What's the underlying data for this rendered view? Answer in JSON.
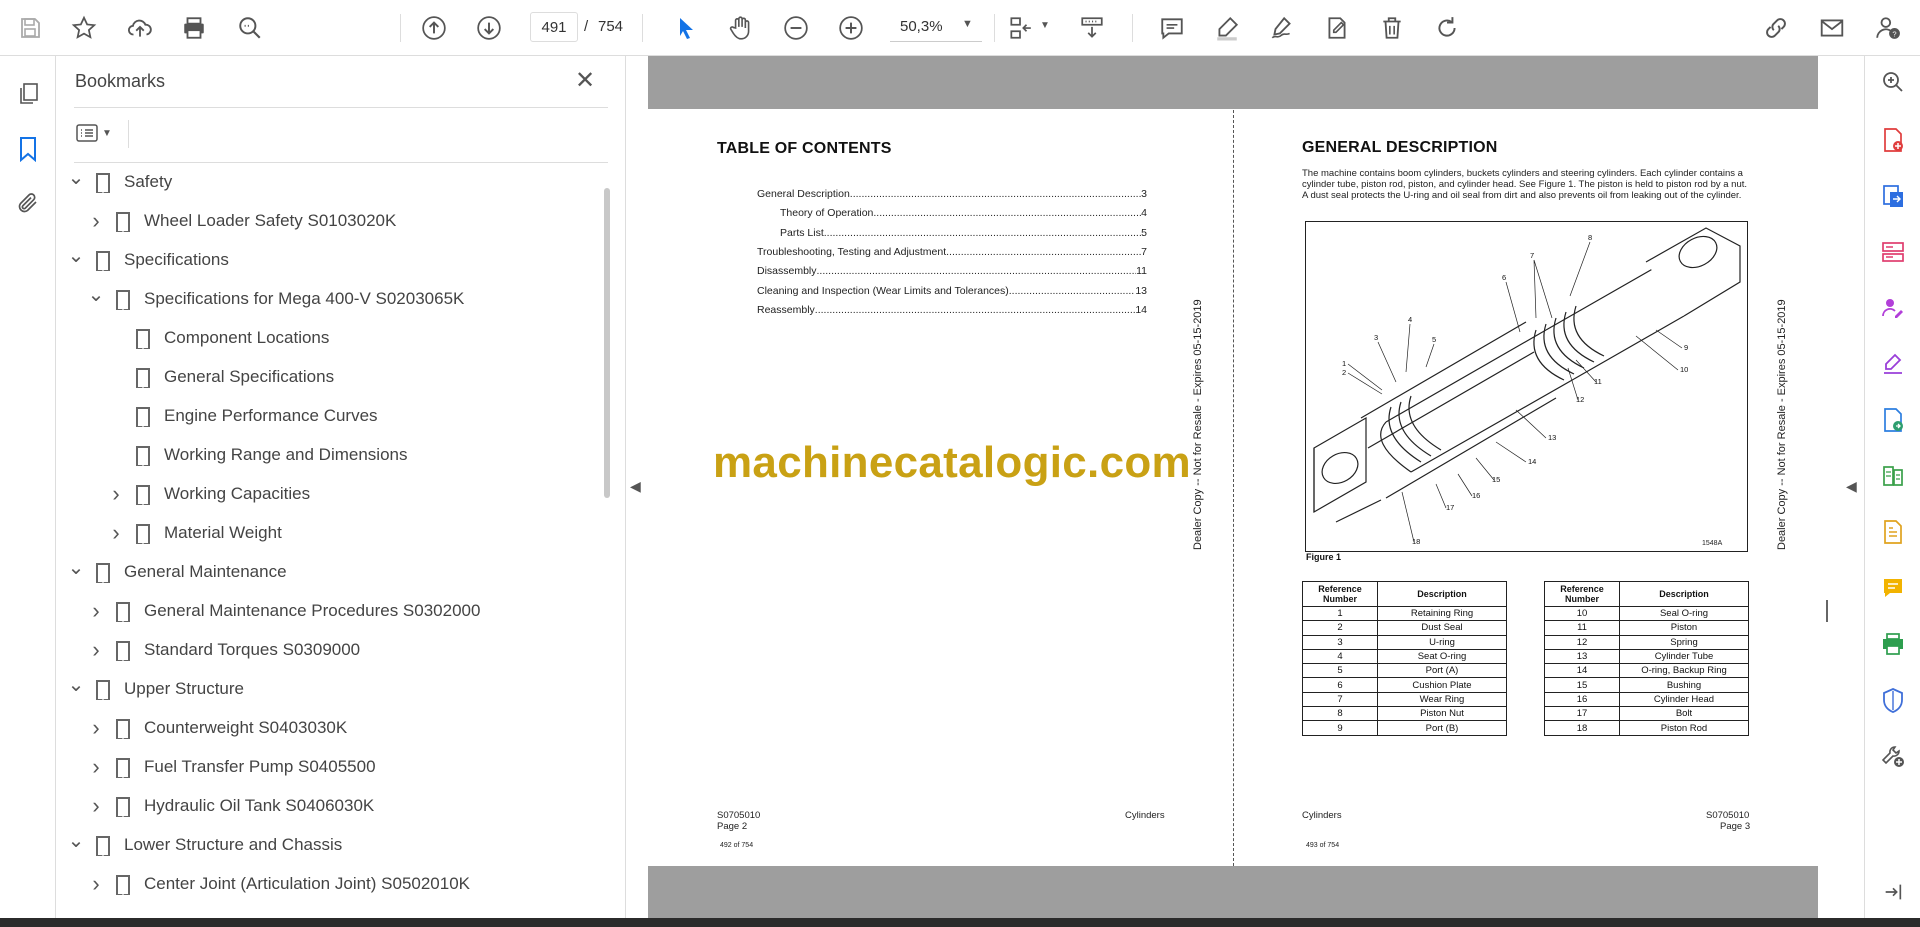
{
  "toolbar": {
    "page_current": "491",
    "page_separator": "/",
    "page_total": "754",
    "zoom": "50,3%"
  },
  "bookmarks": {
    "title": "Bookmarks",
    "items": [
      {
        "label": "Safety",
        "level": 0,
        "toggle": "open"
      },
      {
        "label": "Wheel Loader Safety S0103020K",
        "level": 1,
        "toggle": "closed"
      },
      {
        "label": "Specifications",
        "level": 0,
        "toggle": "open"
      },
      {
        "label": "Specifications for Mega 400-V S0203065K",
        "level": 1,
        "toggle": "open"
      },
      {
        "label": "Component Locations",
        "level": 2,
        "toggle": "none"
      },
      {
        "label": "General Specifications",
        "level": 2,
        "toggle": "none"
      },
      {
        "label": "Engine Performance Curves",
        "level": 2,
        "toggle": "none"
      },
      {
        "label": "Working Range and Dimensions",
        "level": 2,
        "toggle": "none"
      },
      {
        "label": "Working Capacities",
        "level": 2,
        "toggle": "closed"
      },
      {
        "label": "Material Weight",
        "level": 2,
        "toggle": "closed"
      },
      {
        "label": "General Maintenance",
        "level": 0,
        "toggle": "open"
      },
      {
        "label": "General Maintenance Procedures S0302000",
        "level": 1,
        "toggle": "closed"
      },
      {
        "label": "Standard Torques S0309000",
        "level": 1,
        "toggle": "closed"
      },
      {
        "label": "Upper Structure",
        "level": 0,
        "toggle": "open"
      },
      {
        "label": "Counterweight S0403030K",
        "level": 1,
        "toggle": "closed"
      },
      {
        "label": "Fuel Transfer Pump S0405500",
        "level": 1,
        "toggle": "closed"
      },
      {
        "label": "Hydraulic Oil Tank S0406030K",
        "level": 1,
        "toggle": "closed"
      },
      {
        "label": "Lower Structure and Chassis",
        "level": 0,
        "toggle": "open"
      },
      {
        "label": "Center Joint (Articulation Joint) S0502010K",
        "level": 1,
        "toggle": "closed"
      }
    ]
  },
  "left_page": {
    "title": "TABLE OF CONTENTS",
    "toc": [
      {
        "label": "General Description",
        "page": "3",
        "indent": 0
      },
      {
        "label": "Theory of Operation",
        "page": "4",
        "indent": 1
      },
      {
        "label": "Parts List",
        "page": "5",
        "indent": 1
      },
      {
        "label": "Troubleshooting, Testing and Adjustment",
        "page": "7",
        "indent": 0
      },
      {
        "label": "Disassembly",
        "page": "11",
        "indent": 0
      },
      {
        "label": "Cleaning and Inspection (Wear Limits and Tolerances)",
        "page": "13",
        "indent": 0
      },
      {
        "label": "Reassembly",
        "page": "14",
        "indent": 0
      }
    ],
    "side_note": "Dealer Copy -- Not for Resale - Expires 05-15-2019",
    "footer_code": "S0705010",
    "footer_page": "Page 2",
    "footer_section": "Cylinders",
    "footer_pdf_page": "492 of 754"
  },
  "watermark": "machinecatalogic.com",
  "right_page": {
    "title": "GENERAL DESCRIPTION",
    "description": "The machine contains boom cylinders, buckets cylinders and steering cylinders. Each cylinder contains a cylinder tube, piston rod, piston, and cylinder head. See Figure 1. The piston is held to piston rod by a nut. A dust seal protects the U-ring and oil seal from dirt and also prevents oil from leaking out of the cylinder.",
    "figure_caption": "Figure 1",
    "figure_code": "1548A",
    "figure_callouts": [
      "1",
      "2",
      "3",
      "4",
      "5",
      "6",
      "7",
      "8",
      "9",
      "10",
      "11",
      "12",
      "13",
      "14",
      "15",
      "16",
      "17",
      "18"
    ],
    "table_headers": [
      "Reference Number",
      "Description"
    ],
    "table_left": [
      [
        "1",
        "Retaining Ring"
      ],
      [
        "2",
        "Dust Seal"
      ],
      [
        "3",
        "U-ring"
      ],
      [
        "4",
        "Seat O-ring"
      ],
      [
        "5",
        "Port (A)"
      ],
      [
        "6",
        "Cushion Plate"
      ],
      [
        "7",
        "Wear Ring"
      ],
      [
        "8",
        "Piston Nut"
      ],
      [
        "9",
        "Port (B)"
      ]
    ],
    "table_right": [
      [
        "10",
        "Seal O-ring"
      ],
      [
        "11",
        "Piston"
      ],
      [
        "12",
        "Spring"
      ],
      [
        "13",
        "Cylinder Tube"
      ],
      [
        "14",
        "O-ring, Backup Ring"
      ],
      [
        "15",
        "Bushing"
      ],
      [
        "16",
        "Cylinder Head"
      ],
      [
        "17",
        "Bolt"
      ],
      [
        "18",
        "Piston Rod"
      ]
    ],
    "side_note": "Dealer Copy -- Not for Resale - Expires 05-15-2019",
    "footer_section": "Cylinders",
    "footer_code": "S0705010",
    "footer_page": "Page 3",
    "footer_pdf_page": "493 of 754"
  },
  "colors": {
    "accent": "#1473e6",
    "watermark": "#c9a114",
    "page_gray": "#9e9e9e"
  }
}
